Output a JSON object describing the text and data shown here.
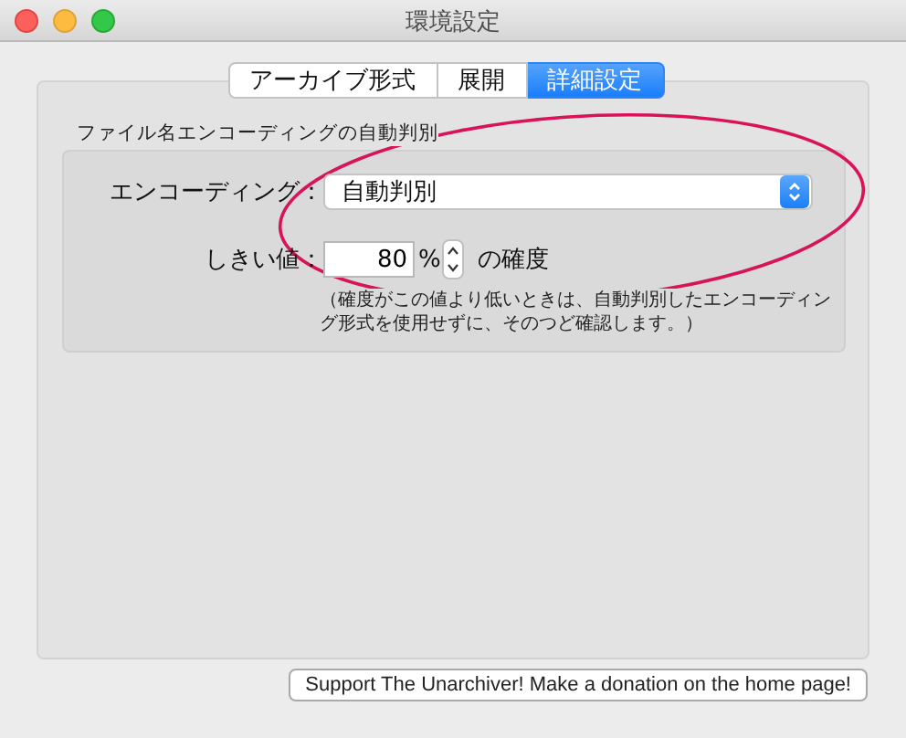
{
  "window": {
    "title": "環境設定"
  },
  "tabs": [
    {
      "label": "アーカイブ形式",
      "selected": false
    },
    {
      "label": "展開",
      "selected": false
    },
    {
      "label": "詳細設定",
      "selected": true
    }
  ],
  "group": {
    "title": "ファイル名エンコーディングの自動判別",
    "encoding": {
      "label": "エンコーディング：",
      "value": "自動判別"
    },
    "threshold": {
      "label": "しきい値：",
      "value": "80",
      "unit": "%",
      "suffix": "の確度"
    },
    "note": "（確度がこの値より低いときは、自動判別したエンコーディング形式を使用せずに、そのつど確認します。）"
  },
  "donate_button": "Support The Unarchiver! Make a donation on the home page!",
  "annotation": {
    "kind": "ellipse"
  }
}
